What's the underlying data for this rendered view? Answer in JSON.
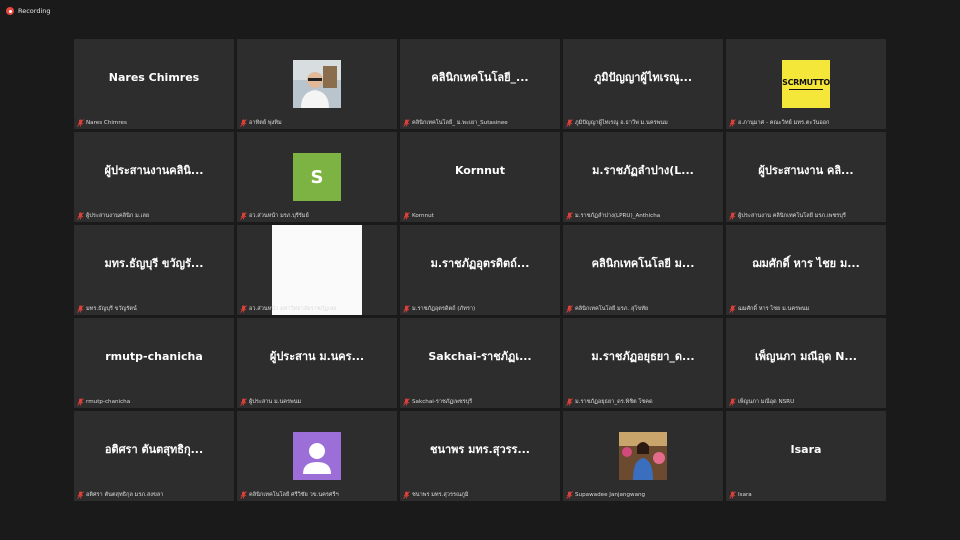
{
  "recording": {
    "label": "Recording",
    "color": "#e8453c"
  },
  "tiles": [
    {
      "display": "Nares Chimres",
      "label": "Nares Chimres"
    },
    {
      "display": "",
      "label": "อาทิตย์ พุ่งทิม",
      "video": "photo-man"
    },
    {
      "display": "คลินิกเทคโนโลยี_...",
      "label": "คลินิกเทคโนโลยี_ ม.พะเยา_Sutasinee"
    },
    {
      "display": "ภูมิปัญญาผู้ไทเรณู...",
      "label": "ภูมิปัญญาผู้ไทเรณู อ.ธาวีพ่ ม.นครพนม"
    },
    {
      "display": "",
      "label": "อ.ภานุมาศ - คณะวิทย์ มทร.ตะวันออก",
      "video": "logo",
      "logo_text": "SCRMUTTO"
    },
    {
      "display": "ผู้ประสานงานคลินิ...",
      "label": "ผู้ประสานงานคลินิก ม.เลย"
    },
    {
      "display": "",
      "label": "อว.ส่วนหน้า มรภ.บุรีรัมย์",
      "video": "avatar-letter",
      "letter": "S",
      "color": "#7cb342"
    },
    {
      "display": "Kornnut",
      "label": "Kornnut"
    },
    {
      "display": "ม.ราชภัฏลำปาง(L...",
      "label": "ม.ราชภัฏลำปาง(LPRU)_Anthicha"
    },
    {
      "display": "ผู้ประสานงาน คลิ...",
      "label": "ผู้ประสานงาน คลินิกเทคโนโลยี มรภ.เพชรบุรี"
    },
    {
      "display": "มทร.ธัญบุรี ขวัญรั...",
      "label": "มทร.ธัญบุรี ขวัญรัตน์"
    },
    {
      "display": "",
      "label": "อว.ส่วนหน้า มหาวิทยาลัยราชภัฏเลย",
      "video": "white"
    },
    {
      "display": "ม.ราชภัฏอุตรดิตถ์...",
      "label": "ม.ราชภัฏอุตรดิตถ์ (ภัทรา)"
    },
    {
      "display": "คลินิกเทคโนโลยี ม...",
      "label": "คลินิกเทคโนโลยี มรภ. สุโขทัย"
    },
    {
      "display": "ฌมศักดิ์ หาร ไชย ม...",
      "label": "ฌมศักดิ์ หาร ไชย ม.นครพนม"
    },
    {
      "display": "rmutp-chanicha",
      "label": "rmutp-chanicha"
    },
    {
      "display": "ผู้ประสาน ม.นคร...",
      "label": "ผู้ประสาน ม.นครพนม"
    },
    {
      "display": "Sakchai-ราชภัฏเ...",
      "label": "Sakchai-ราชภัฏเพชรบุรี"
    },
    {
      "display": "ม.ราชภัฏอยุธยา_ด...",
      "label": "ม.ราชภัฏอยุธยา_ดร.พิชิต โชคด"
    },
    {
      "display": "เพ็ญนภา มณีอุด N...",
      "label": "เพ็ญนภา มณีอุด NSRU"
    },
    {
      "display": "อติศรา ตันตสุทธิกุ...",
      "label": "อติศรา ตันตสุทธิกุล มรภ.สงขลา"
    },
    {
      "display": "",
      "label": "คลินิกเทคโนโลยี ศรีวิชัย วข.นครศรีฯ",
      "video": "avatar-person",
      "color": "#9b6ed8"
    },
    {
      "display": "ชนาพร มทร.สุวรร...",
      "label": "ชนาพร มทร.สุวรรณภูมิ"
    },
    {
      "display": "",
      "label": "Supawadee Janjangwang",
      "video": "photo-woman"
    },
    {
      "display": "Isara",
      "label": "Isara"
    }
  ],
  "colors": {
    "background": "#1a1a1a",
    "tile": "#2d2d2d",
    "muted_mic": "#e0403a"
  }
}
